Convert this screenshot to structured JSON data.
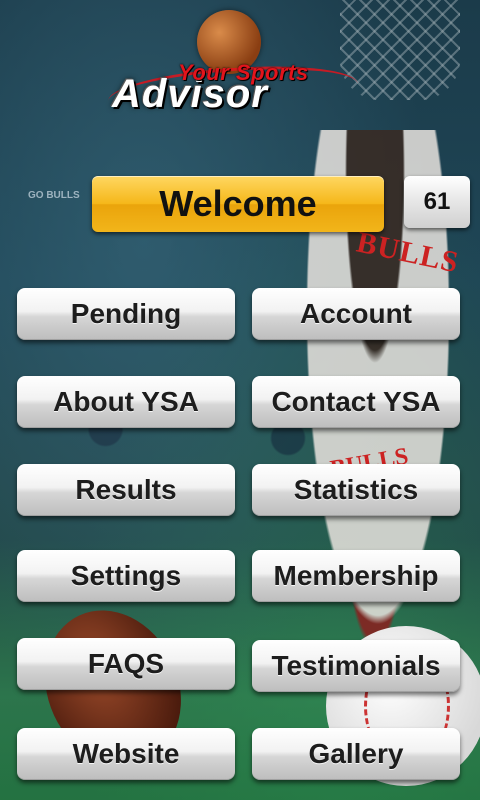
{
  "logo": {
    "line1": "Your Sports",
    "line2": "Advisor"
  },
  "background": {
    "banner_text": "GO BULLS",
    "jersey_text": "BULLS"
  },
  "welcome": {
    "label": "Welcome",
    "count": "61"
  },
  "menu": {
    "pending": "Pending",
    "account": "Account",
    "about": "About YSA",
    "contact": "Contact YSA",
    "results": "Results",
    "statistics": "Statistics",
    "settings": "Settings",
    "membership": "Membership",
    "faqs": "FAQS",
    "testimonials": "Testimonials",
    "website": "Website",
    "gallery": "Gallery"
  }
}
